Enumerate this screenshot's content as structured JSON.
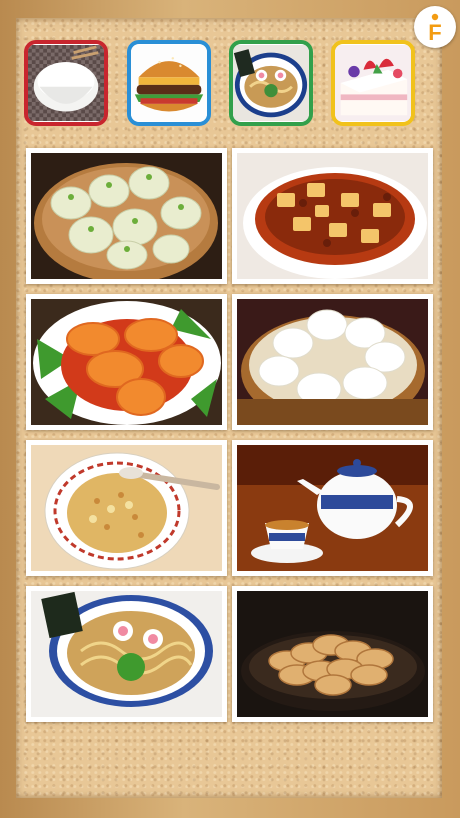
{
  "app": {
    "logo_icon": "fs-logo-icon",
    "logo_text": "F",
    "accent_color": "#f39c12"
  },
  "categories": [
    {
      "id": "rice",
      "icon": "rice-bowl-image",
      "border": "#c8262e"
    },
    {
      "id": "burger",
      "icon": "hamburger-image",
      "border": "#2a8fd6"
    },
    {
      "id": "ramen",
      "icon": "ramen-image",
      "border": "#32a04b"
    },
    {
      "id": "cake",
      "icon": "strawberry-cake-image",
      "border": "#f1c21c"
    }
  ],
  "dishes": [
    {
      "icon": "shumai-dumplings-image"
    },
    {
      "icon": "mapo-tofu-image"
    },
    {
      "icon": "chili-shrimp-image"
    },
    {
      "icon": "steamed-buns-image"
    },
    {
      "icon": "fried-rice-image"
    },
    {
      "icon": "chinese-tea-set-image"
    },
    {
      "icon": "ramen-bowl-image"
    },
    {
      "icon": "gyoza-image"
    }
  ]
}
